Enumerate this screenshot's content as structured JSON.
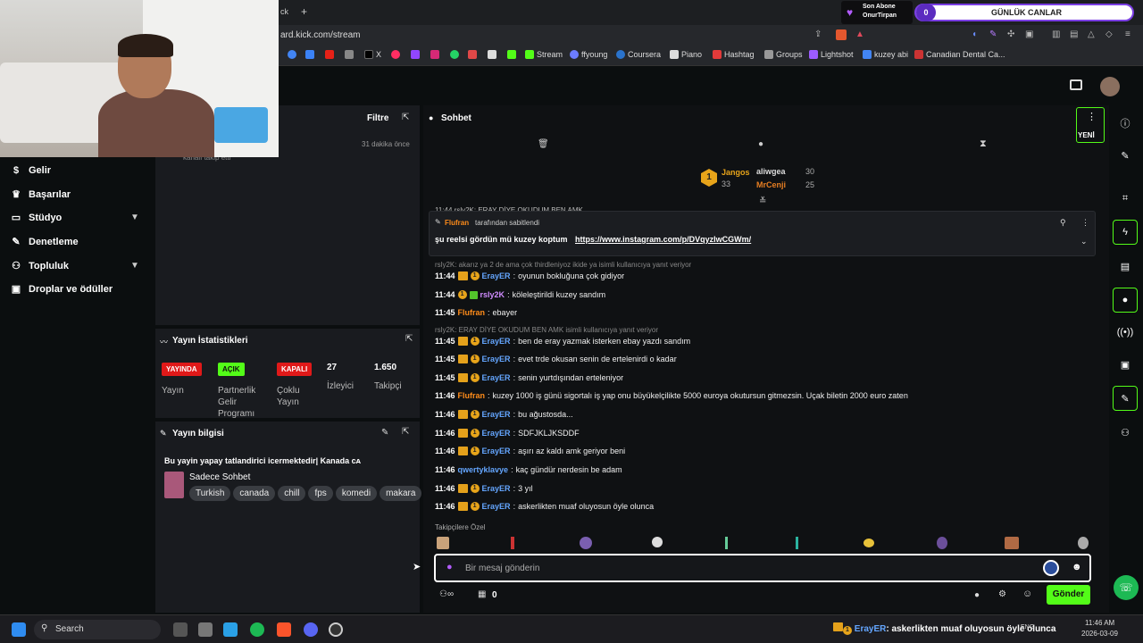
{
  "browser": {
    "url": "ard.kick.com/stream",
    "tab_fragment": "ck",
    "new_tab": "+",
    "bookmarks": [
      "X",
      "Stream",
      "ffyoung",
      "Coursera",
      "Piano",
      "Hashtag",
      "Groups",
      "Lightshot",
      "kuzey abi",
      "Canadian Dental Ca..."
    ],
    "sub_widget": {
      "line1": "Son Abone",
      "line2": "OnurTirpan"
    },
    "gunluk": {
      "count": "0",
      "label": "GÜNLÜK CANLAR"
    }
  },
  "sidebar": {
    "items": [
      {
        "label": "Gelir",
        "icon": "dollar-icon"
      },
      {
        "label": "Başarılar",
        "icon": "trophy-icon"
      },
      {
        "label": "Stüdyo",
        "icon": "studio-icon"
      },
      {
        "label": "Denetleme",
        "icon": "wrench-icon"
      },
      {
        "label": "Topluluk",
        "icon": "community-icon"
      },
      {
        "label": "Droplar ve ödüller",
        "icon": "drops-icon"
      }
    ]
  },
  "activity": {
    "filter_label": "Filtre",
    "time": "31 dakika önce",
    "partial_text": "kanalı takip etti"
  },
  "stats": {
    "title": "Yayın İstatistikleri",
    "live_badge": "YAYINDA",
    "live_label": "Yayın",
    "partner_badge": "AÇIK",
    "partner_label": "Partnerlik Gelir Programı",
    "multi_badge": "KAPALI",
    "multi_label": "Çoklu Yayın",
    "viewers": "27",
    "viewers_label": "İzleyici",
    "followers": "1.650",
    "followers_label": "Takipçi"
  },
  "info": {
    "title": "Yayın bilgisi",
    "stream_title": "Bu yayin yapay tatlandirici icermektedir| Kanada ᴄᴀ",
    "category": "Sadece Sohbet",
    "tags": [
      "Turkish",
      "canada",
      "chill",
      "fps",
      "komedi",
      "makara"
    ]
  },
  "chat": {
    "title": "Sohbet",
    "new_label": "YENİ",
    "top": {
      "first": {
        "name": "Jangos",
        "score": "33"
      },
      "second": {
        "name": "aliwgea",
        "score": "30"
      },
      "third": {
        "name": "MrCenji",
        "score": "25"
      }
    },
    "cut_line": "11:44 rsly2K: ERAY DİYE OKUDUM BEN AMK",
    "pinned": {
      "by": "Flufran",
      "by_suffix": "tarafından sabitlendi",
      "text": "şu reelsi gördün mü kuzey koptum",
      "link": "https://www.instagram.com/p/DVqyzlwCGWm/"
    },
    "reply1": "rsly2K: akarız ya 2 de ama çok thirdleniyoz ikide ya isimli kullanıcıya yanıt veriyor",
    "reply2": "rsly2K: ERAY DİYE OKUDUM BEN AMK isimli kullanıcıya yanıt veriyor",
    "messages": [
      {
        "time": "11:44",
        "user": "ErayER",
        "color": "#64a6ff",
        "text": "oyunun bokluğuna çok gidiyor"
      },
      {
        "time": "11:44",
        "user": "rsly2K",
        "color": "#d08cff",
        "text": "köleleştirildi kuzey sandım"
      },
      {
        "time": "11:45",
        "user": "Flufran",
        "color": "#ff8c1a",
        "text": "ebayer"
      },
      {
        "time": "11:45",
        "user": "ErayER",
        "color": "#64a6ff",
        "text": "ben de eray yazmak isterken ebay yazdı sandım"
      },
      {
        "time": "11:45",
        "user": "ErayER",
        "color": "#64a6ff",
        "text": "evet trde okusan senin de ertelenirdi o kadar"
      },
      {
        "time": "11:45",
        "user": "ErayER",
        "color": "#64a6ff",
        "text": "senin yurtdışından erteleniyor"
      },
      {
        "time": "11:46",
        "user": "Flufran",
        "color": "#ff8c1a",
        "text": "kuzey 1000 iş günü sigortalı iş yap onu büyükelçilikte 5000 euroya okutursun gitmezsin. Uçak biletin 2000 euro zaten"
      },
      {
        "time": "11:46",
        "user": "ErayER",
        "color": "#64a6ff",
        "text": "bu ağustosda..."
      },
      {
        "time": "11:46",
        "user": "ErayER",
        "color": "#64a6ff",
        "text": "SDFJKLJKSDDF"
      },
      {
        "time": "11:46",
        "user": "ErayER",
        "color": "#64a6ff",
        "text": "aşırı az kaldı amk geriyor beni"
      },
      {
        "time": "11:46",
        "user": "qwertyklavye",
        "color": "#64a6ff",
        "text": "kaç gündür nerdesin be adam"
      },
      {
        "time": "11:46",
        "user": "ErayER",
        "color": "#64a6ff",
        "text": "3 yıl"
      },
      {
        "time": "11:46",
        "user": "ErayER",
        "color": "#64a6ff",
        "text": "askerlikten muaf oluyosun öyle olunca"
      }
    ],
    "followers_only": "Takipçilere Özel",
    "input_placeholder": "Bir mesaj gönderin",
    "points": "0",
    "send_label": "Gönder"
  },
  "taskbar": {
    "search": "Search",
    "notice_user": "ErayER",
    "notice_text": ": askerlikten muaf oluyosun öyle olunca",
    "lang": "ENG",
    "time": "11:46 AM",
    "date": "2026-03-09"
  },
  "colors": {
    "accent": "#53fc18",
    "live": "#e01919",
    "partner": "#53fc18"
  }
}
